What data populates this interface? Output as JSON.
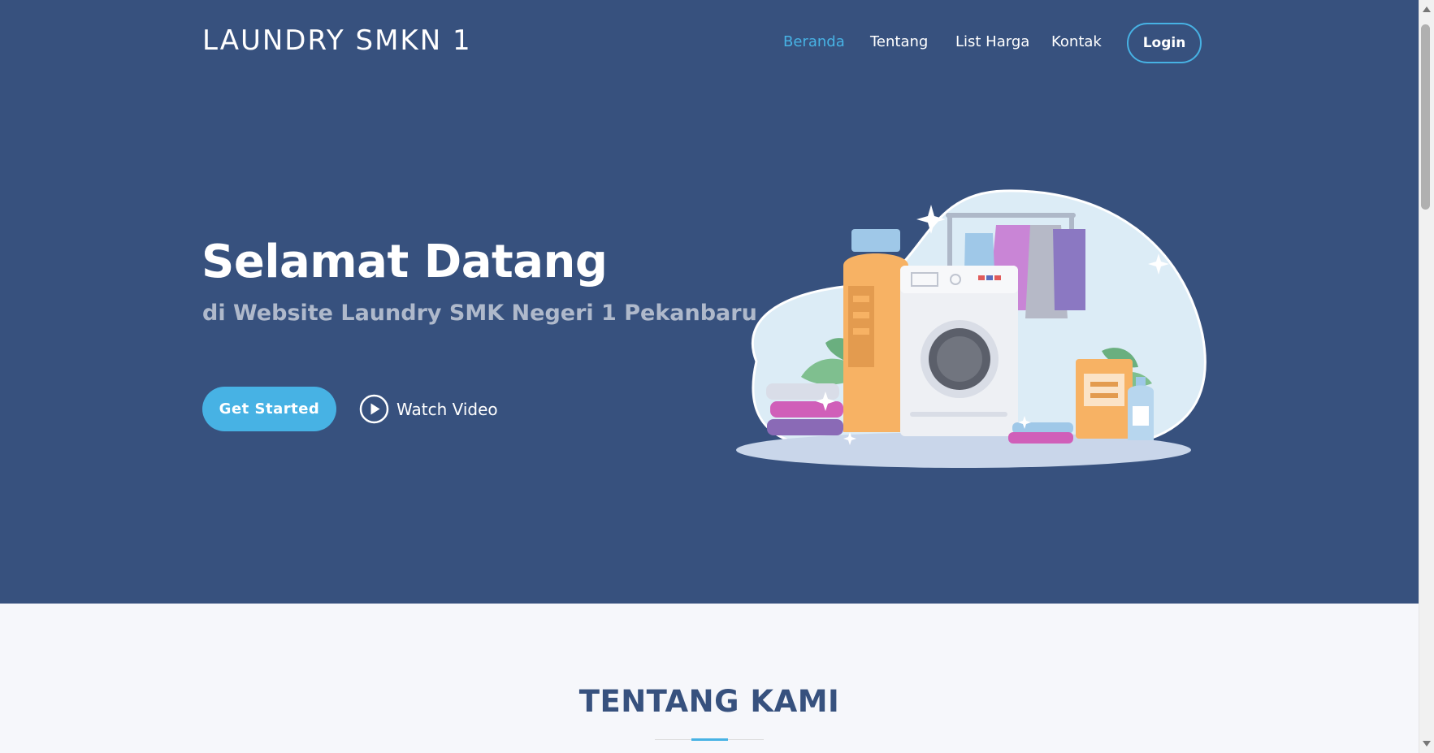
{
  "header": {
    "logo": "LAUNDRY SMKN 1",
    "nav": [
      "Beranda",
      "Tentang",
      "List Harga",
      "Kontak"
    ],
    "active_nav": "Beranda",
    "login_label": "Login"
  },
  "hero": {
    "title": "Selamat Datang",
    "subtitle": "di Website Laundry SMK Negeri 1 Pekanbaru",
    "primary_button": "Get Started",
    "video_button": "Watch Video",
    "illustration_icon": "laundry-illustration"
  },
  "about": {
    "title": "TENTANG KAMI"
  },
  "colors": {
    "hero_background": "#37517e",
    "accent": "#47b2e4",
    "page_background": "#f6f7fb",
    "white": "#ffffff"
  }
}
